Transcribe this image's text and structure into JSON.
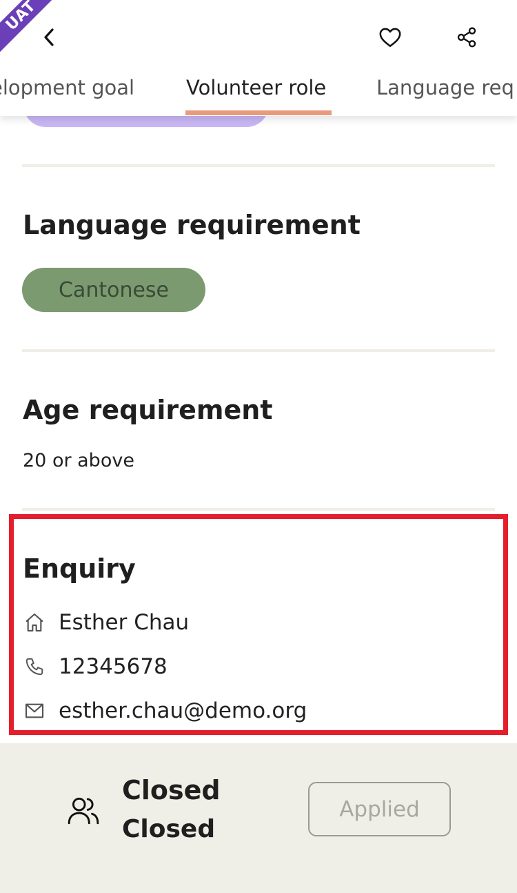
{
  "header": {
    "ribbon_text": "UAT",
    "tabs": [
      {
        "label": "elopment goal"
      },
      {
        "label": "Volunteer role"
      },
      {
        "label": "Language req"
      }
    ],
    "icons": {
      "back": "chevron-left-icon",
      "favorite": "heart-icon",
      "share": "share-icon"
    },
    "accent_color": "#e89a7c"
  },
  "sections": {
    "language": {
      "title": "Language requirement",
      "chip": "Cantonese"
    },
    "age": {
      "title": "Age requirement",
      "value": "20 or above"
    },
    "enquiry": {
      "title": "Enquiry",
      "contact_name": "Esther Chau",
      "phone": "12345678",
      "email": "esther.chau@demo.org"
    }
  },
  "footer": {
    "status_line_1": "Closed",
    "status_line_2": "Closed",
    "applied_button": "Applied"
  },
  "colors": {
    "chip_bg": "#7b9a70",
    "highlight_border": "#e41e2b",
    "footer_bg": "#f0efe7",
    "purple_pill": "#c9b7f5"
  }
}
